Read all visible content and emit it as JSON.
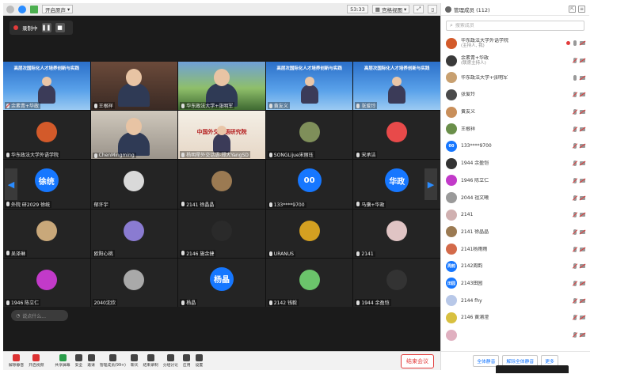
{
  "topbar": {
    "audio_toggle_label": "开启原声",
    "timer": "53:33",
    "view_mode_label": "宫格视图"
  },
  "recording": {
    "label": "录制中"
  },
  "tiles": [
    {
      "name": "余素青+华政",
      "kind": "slide",
      "slide_title": "高层次国际化人才培养创新与实践",
      "mic": "off",
      "icon": "person"
    },
    {
      "name": "王根祥",
      "kind": "camera",
      "mic": "on",
      "icon": ""
    },
    {
      "name": "华东政法大学+张明军",
      "kind": "camera-green",
      "mic": "on",
      "icon": ""
    },
    {
      "name": "黄友义",
      "kind": "slide",
      "slide_title": "高层次国际化人才培养创新与实践",
      "mic": "on",
      "icon": ""
    },
    {
      "name": "张爱玲",
      "kind": "slide",
      "slide_title": "高层次国际化人才培养创新与实践",
      "mic": "on",
      "icon": ""
    },
    {
      "name": "华东政法大学外语学院",
      "kind": "avatar",
      "avatar_color": "#d35a2a",
      "mic": "on",
      "icon": "person"
    },
    {
      "name": "ChenMingming",
      "kind": "camera-room",
      "mic": "on",
      "icon": ""
    },
    {
      "name": "杨明星外交话语-郑大YangSD",
      "kind": "poster",
      "slide_title": "中国外交话语研究院",
      "mic": "on",
      "icon": ""
    },
    {
      "name": "SONGLijue宋丽珏",
      "kind": "avatar",
      "avatar_color": "#7f8f5a",
      "mic": "on",
      "icon": ""
    },
    {
      "name": "宋承洁",
      "kind": "avatar",
      "avatar_color": "#e84a4a",
      "mic": "on",
      "icon": ""
    },
    {
      "name": "外院 研2029 徐统",
      "kind": "text-avatar",
      "avatar_text": "徐统",
      "mic": "on",
      "icon": ""
    },
    {
      "name": "郁许宇",
      "kind": "avatar",
      "avatar_color": "#d9d9d9",
      "mic": "none",
      "icon": ""
    },
    {
      "name": "2141 徐晶晶",
      "kind": "avatar",
      "avatar_color": "#9b7a52",
      "mic": "on",
      "icon": ""
    },
    {
      "name": "133****9700",
      "kind": "text-avatar",
      "avatar_text": "00",
      "mic": "on",
      "icon": ""
    },
    {
      "name": "马骥+华政",
      "kind": "text-avatar",
      "avatar_text": "华政",
      "mic": "on",
      "icon": ""
    },
    {
      "name": "吴泽琳",
      "kind": "avatar",
      "avatar_color": "#c9a87a",
      "mic": "on",
      "icon": ""
    },
    {
      "name": "欧阳心桃",
      "kind": "avatar",
      "avatar_color": "#8a7bd1",
      "mic": "none",
      "icon": ""
    },
    {
      "name": "2146 施余捷",
      "kind": "avatar",
      "avatar_color": "#2a2a2a",
      "mic": "on",
      "icon": ""
    },
    {
      "name": "URANUS",
      "kind": "avatar",
      "avatar_color": "#d4a021",
      "mic": "on",
      "icon": ""
    },
    {
      "name": "2141",
      "kind": "avatar",
      "avatar_color": "#e0c4c4",
      "mic": "on",
      "icon": ""
    },
    {
      "name": "1946 陈立仁",
      "kind": "avatar",
      "avatar_color": "#c23ac9",
      "mic": "on",
      "icon": ""
    },
    {
      "name": "2040沈欣",
      "kind": "avatar",
      "avatar_color": "#a9a9a9",
      "mic": "none",
      "icon": ""
    },
    {
      "name": "杨晶",
      "kind": "text-avatar",
      "avatar_text": "杨晶",
      "mic": "on",
      "icon": ""
    },
    {
      "name": "2142 钱毅",
      "kind": "avatar",
      "avatar_color": "#6bc46b",
      "mic": "on",
      "icon": ""
    },
    {
      "name": "1944 余盈恺",
      "kind": "avatar",
      "avatar_color": "#333333",
      "mic": "on",
      "icon": ""
    }
  ],
  "chat": {
    "placeholder": "说点什么..."
  },
  "toolbar": {
    "items": [
      "解除静音",
      "开启视频",
      "共享屏幕",
      "安全",
      "邀请",
      "管理成员(99+)",
      "聊天",
      "结束录制",
      "分组讨论",
      "应用",
      "设置"
    ],
    "end_meeting": "结束会议"
  },
  "panel": {
    "title": "管理成员 (112)",
    "search_placeholder": "搜索成员",
    "members": [
      {
        "name": "华东政法大学外语学院",
        "sub": "(主持人, 我)",
        "avatar_color": "#d35a2a",
        "avatar_text": "",
        "rec": true,
        "mic": "on",
        "cam": "off"
      },
      {
        "name": "余素青+华政",
        "sub": "(联席主持人)",
        "avatar_color": "#3a3a3a",
        "avatar_text": "",
        "rec": false,
        "mic": "off",
        "cam": "off"
      },
      {
        "name": "华东政法大学+张明军",
        "sub": "",
        "avatar_color": "#c8a070",
        "avatar_text": "",
        "rec": false,
        "mic": "on",
        "cam": "off"
      },
      {
        "name": "张爱玲",
        "sub": "",
        "avatar_color": "#4a4a4a",
        "avatar_text": "",
        "rec": false,
        "mic": "off",
        "cam": "off"
      },
      {
        "name": "黄友义",
        "sub": "",
        "avatar_color": "#c98f5a",
        "avatar_text": "",
        "rec": false,
        "mic": "off",
        "cam": "off"
      },
      {
        "name": "王根祥",
        "sub": "",
        "avatar_color": "#6a8f4a",
        "avatar_text": "",
        "rec": false,
        "mic": "off",
        "cam": "off"
      },
      {
        "name": "133****9700",
        "sub": "",
        "avatar_color": "#1677ff",
        "avatar_text": "00",
        "rec": false,
        "mic": "off",
        "cam": "off"
      },
      {
        "name": "1944 余盈恺",
        "sub": "",
        "avatar_color": "#333333",
        "avatar_text": "",
        "rec": false,
        "mic": "off",
        "cam": "off"
      },
      {
        "name": "1946 陈立仁",
        "sub": "",
        "avatar_color": "#c23ac9",
        "avatar_text": "",
        "rec": false,
        "mic": "off",
        "cam": "off"
      },
      {
        "name": "2044 祖文曦",
        "sub": "",
        "avatar_color": "#9a9a9a",
        "avatar_text": "",
        "rec": false,
        "mic": "off",
        "cam": "off"
      },
      {
        "name": "2141",
        "sub": "",
        "avatar_color": "#d0b0b0",
        "avatar_text": "",
        "rec": false,
        "mic": "off",
        "cam": "off"
      },
      {
        "name": "2141 徐晶晶",
        "sub": "",
        "avatar_color": "#9b7a52",
        "avatar_text": "",
        "rec": false,
        "mic": "off",
        "cam": "off"
      },
      {
        "name": "2141杨雨雨",
        "sub": "",
        "avatar_color": "#d36a4a",
        "avatar_text": "",
        "rec": false,
        "mic": "off",
        "cam": "off"
      },
      {
        "name": "2142周韵",
        "sub": "",
        "avatar_color": "#1677ff",
        "avatar_text": "周韵",
        "rec": false,
        "mic": "off",
        "cam": "off"
      },
      {
        "name": "2143田园",
        "sub": "",
        "avatar_color": "#1677ff",
        "avatar_text": "田园",
        "rec": false,
        "mic": "off",
        "cam": "off"
      },
      {
        "name": "2144 fhy",
        "sub": "",
        "avatar_color": "#b8c8e8",
        "avatar_text": "",
        "rec": false,
        "mic": "off",
        "cam": "off"
      },
      {
        "name": "2146 黄浦滢",
        "sub": "",
        "avatar_color": "#d8c040",
        "avatar_text": "",
        "rec": false,
        "mic": "off",
        "cam": "off"
      },
      {
        "name": "",
        "sub": "",
        "avatar_color": "#e0b0c0",
        "avatar_text": "",
        "rec": false,
        "mic": "off",
        "cam": "off"
      }
    ],
    "buttons": [
      "全体静音",
      "解除全体静音",
      "更多"
    ]
  },
  "colors": {
    "accent": "#1677ff",
    "danger": "#e23b3b",
    "video_bg": "#1b1b1b"
  }
}
